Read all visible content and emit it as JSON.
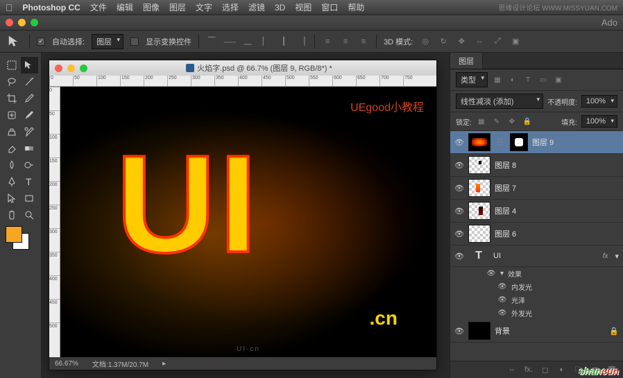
{
  "menubar": {
    "app_name": "Photoshop CC",
    "items": [
      "文件",
      "编辑",
      "图像",
      "图层",
      "文字",
      "选择",
      "滤镜",
      "3D",
      "视图",
      "窗口",
      "帮助"
    ]
  },
  "watermark_top": "思缘设计论坛  WWW.MISSYUAN.COM",
  "brand_right": "Ado",
  "options": {
    "auto_select_label": "自动选择:",
    "auto_select_value": "图层",
    "show_transform": "显示变换控件",
    "mode_3d": "3D 模式:"
  },
  "document": {
    "title": "火焰字.psd @ 66.7% (图层 9, RGB/8*) *",
    "rulers_h": [
      "0",
      "50",
      "100",
      "150",
      "200",
      "250",
      "300",
      "350",
      "400",
      "450",
      "500",
      "550",
      "600",
      "650",
      "700",
      "750"
    ],
    "rulers_v": [
      "0",
      "50",
      "100",
      "150",
      "200",
      "250",
      "300",
      "350",
      "400",
      "450",
      "500"
    ],
    "tutorial_label": "UEgood小教程",
    "fire_text": "UI",
    "fire_suffix": ".cn",
    "canvas_watermark": "UI·cn",
    "zoom": "66.67%",
    "filesize": "文档:1.37M/20.7M"
  },
  "layers_panel": {
    "tab": "图层",
    "kind_label": "类型",
    "blend_mode": "线性减淡 (添加)",
    "opacity_label": "不透明度:",
    "opacity_value": "100%",
    "lock_label": "锁定:",
    "fill_label": "填充:",
    "fill_value": "100%",
    "layers": [
      {
        "name": "图层 9",
        "selected": true,
        "hasMask": true,
        "thumb": "fire"
      },
      {
        "name": "图层 8",
        "thumb": "checker"
      },
      {
        "name": "图层 7",
        "thumb": "checker"
      },
      {
        "name": "图层 4",
        "thumb": "checker"
      },
      {
        "name": "图层 6",
        "thumb": "checker"
      }
    ],
    "text_layer": {
      "name": "UI",
      "fx_label": "fx"
    },
    "effects_label": "效果",
    "effects": [
      "内发光",
      "光泽",
      "外发光"
    ],
    "background": {
      "name": "背景"
    }
  },
  "bottom_watermark": {
    "a": "shan",
    "b": "cun"
  }
}
